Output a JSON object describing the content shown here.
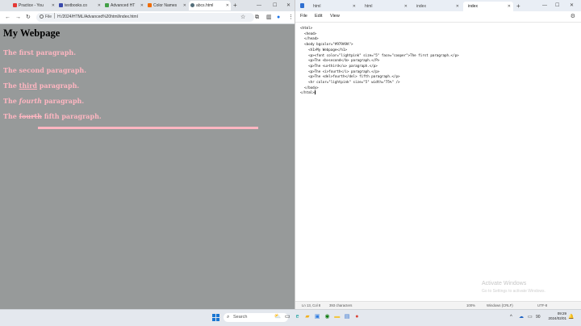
{
  "browser": {
    "tabs": [
      {
        "label": "Practice - You",
        "color": "#e53935"
      },
      {
        "label": "textbooks.co",
        "color": "#3949ab"
      },
      {
        "label": "Advanced HT",
        "color": "#43a047"
      },
      {
        "label": "Color Names",
        "color": "#ef6c00"
      },
      {
        "label": "abcs.html",
        "color": "#546e7a"
      }
    ],
    "new_tab": "+",
    "controls": {
      "min": "—",
      "max": "☐",
      "close": "✕"
    },
    "nav": {
      "back": "←",
      "forward": "→",
      "reload": "↻"
    },
    "address": {
      "scheme": "File",
      "url": "H:/2024/HTML/Advanced%20html/index.html"
    },
    "page": {
      "bgcolor": "#979A9A",
      "heading": "My Webpage",
      "paragraphs": [
        {
          "parts": [
            {
              "t": "The first paragraph.",
              "s": "plain"
            }
          ]
        },
        {
          "parts": [
            {
              "t": "The ",
              "s": "plain"
            },
            {
              "t": "second",
              "s": "b"
            },
            {
              "t": " paragraph.",
              "s": "plain"
            }
          ]
        },
        {
          "parts": [
            {
              "t": "The ",
              "s": "plain"
            },
            {
              "t": "third",
              "s": "u"
            },
            {
              "t": " paragraph.",
              "s": "plain"
            }
          ]
        },
        {
          "parts": [
            {
              "t": "The ",
              "s": "plain"
            },
            {
              "t": "fourth",
              "s": "i"
            },
            {
              "t": " paragraph.",
              "s": "plain"
            }
          ]
        },
        {
          "parts": [
            {
              "t": "The ",
              "s": "plain"
            },
            {
              "t": "fourth",
              "s": "del"
            },
            {
              "t": " fifth paragraph.",
              "s": "plain"
            }
          ]
        }
      ],
      "paragraph_color": "#FFB6C1"
    }
  },
  "notepad": {
    "tabs": [
      {
        "label": "html",
        "active": false
      },
      {
        "label": "html",
        "active": false
      },
      {
        "label": "index",
        "active": false
      },
      {
        "label": "index",
        "active": true
      }
    ],
    "new_tab": "+",
    "menu": [
      "File",
      "Edit",
      "View"
    ],
    "code_lines": [
      "<html>",
      "  <head>",
      "  </head>",
      "  <body bgcolor=\"#979A9A\">",
      "    <h1>My Webpage</h1>",
      "    <p><font color=\"lightpink\" size=\"5\" face=\"cooper\">The first paragraph.</p>",
      "    <p>The <b>second</b> paragraph.</P>",
      "    <p>The <u>third</u> paragraph.</p>",
      "    <p>The <i>fourth</i> paragraph.</p>",
      "    <p>The <del>fourth</del> fifth paragraph.</p>",
      "    <hr color=\"lightpink\" size=\"5\" width=\"75%\" />",
      "  </body>",
      "</html>"
    ],
    "watermark": {
      "title": "Activate Windows",
      "subtitle": "Go to Settings to activate Windows."
    },
    "status": {
      "position": "Ln 13, Col 8",
      "chars": "393 characters",
      "zoom": "100%",
      "eol": "Windows (CRLF)",
      "encoding": "UTF-8"
    }
  },
  "taskbar": {
    "search_placeholder": "Search",
    "time": "09:29",
    "date": "2024/02/01",
    "apps": [
      {
        "name": "widgets",
        "glyph": "⛅",
        "color": "#f5a623"
      },
      {
        "name": "task-view",
        "glyph": "▭",
        "color": "#333333"
      },
      {
        "name": "edge",
        "glyph": "e",
        "color": "#0f9d9a"
      },
      {
        "name": "explorer",
        "glyph": "▰",
        "color": "#f2b01e"
      },
      {
        "name": "store",
        "glyph": "▣",
        "color": "#2d7be0"
      },
      {
        "name": "xbox",
        "glyph": "◉",
        "color": "#107c10"
      },
      {
        "name": "files",
        "glyph": "▬",
        "color": "#f2c744"
      },
      {
        "name": "notepad",
        "glyph": "▤",
        "color": "#2f6fd0"
      },
      {
        "name": "chrome",
        "glyph": "●",
        "color": "#db4437"
      }
    ],
    "tray": {
      "chevron": "^",
      "cloud": "☁",
      "display": "▭",
      "volume": "🔊",
      "battery": "90"
    }
  }
}
